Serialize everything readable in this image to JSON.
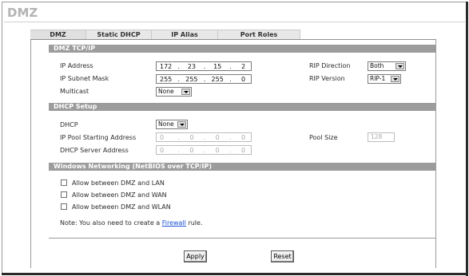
{
  "page": {
    "title": "DMZ"
  },
  "tabs": [
    {
      "label": "DMZ",
      "active": true
    },
    {
      "label": "Static DHCP",
      "active": false
    },
    {
      "label": "IP Alias",
      "active": false
    },
    {
      "label": "Port Roles",
      "active": false
    }
  ],
  "tcpip": {
    "header": "DMZ TCP/IP",
    "ip_address_label": "IP Address",
    "ip_address": [
      "172",
      "23",
      "15",
      "2"
    ],
    "subnet_label": "IP Subnet Mask",
    "subnet": [
      "255",
      "255",
      "255",
      "0"
    ],
    "multicast_label": "Multicast",
    "multicast_value": "None",
    "rip_direction_label": "RIP Direction",
    "rip_direction_value": "Both",
    "rip_version_label": "RIP Version",
    "rip_version_value": "RIP-1"
  },
  "dhcp": {
    "header": "DHCP Setup",
    "dhcp_label": "DHCP",
    "dhcp_value": "None",
    "pool_start_label": "IP Pool Starting Address",
    "pool_start": [
      "0",
      "0",
      "0",
      "0"
    ],
    "server_label": "DHCP Server Address",
    "server": [
      "0",
      "0",
      "0",
      "0"
    ],
    "pool_size_label": "Pool Size",
    "pool_size_value": "128"
  },
  "netbios": {
    "header": "Windows Networking (NetBIOS over TCP/IP)",
    "options": [
      {
        "label": "Allow between DMZ and LAN",
        "checked": false
      },
      {
        "label": "Allow between DMZ and WAN",
        "checked": false
      },
      {
        "label": "Allow between DMZ and WLAN",
        "checked": false
      }
    ],
    "note_prefix": "Note: You also need to create a ",
    "note_link": "Firewall",
    "note_suffix": " rule."
  },
  "buttons": {
    "apply": "Apply",
    "reset": "Reset"
  },
  "colors": {
    "section_bar": "#9c9c9c",
    "link": "#1a4fd6",
    "title": "#b3b3b3"
  }
}
